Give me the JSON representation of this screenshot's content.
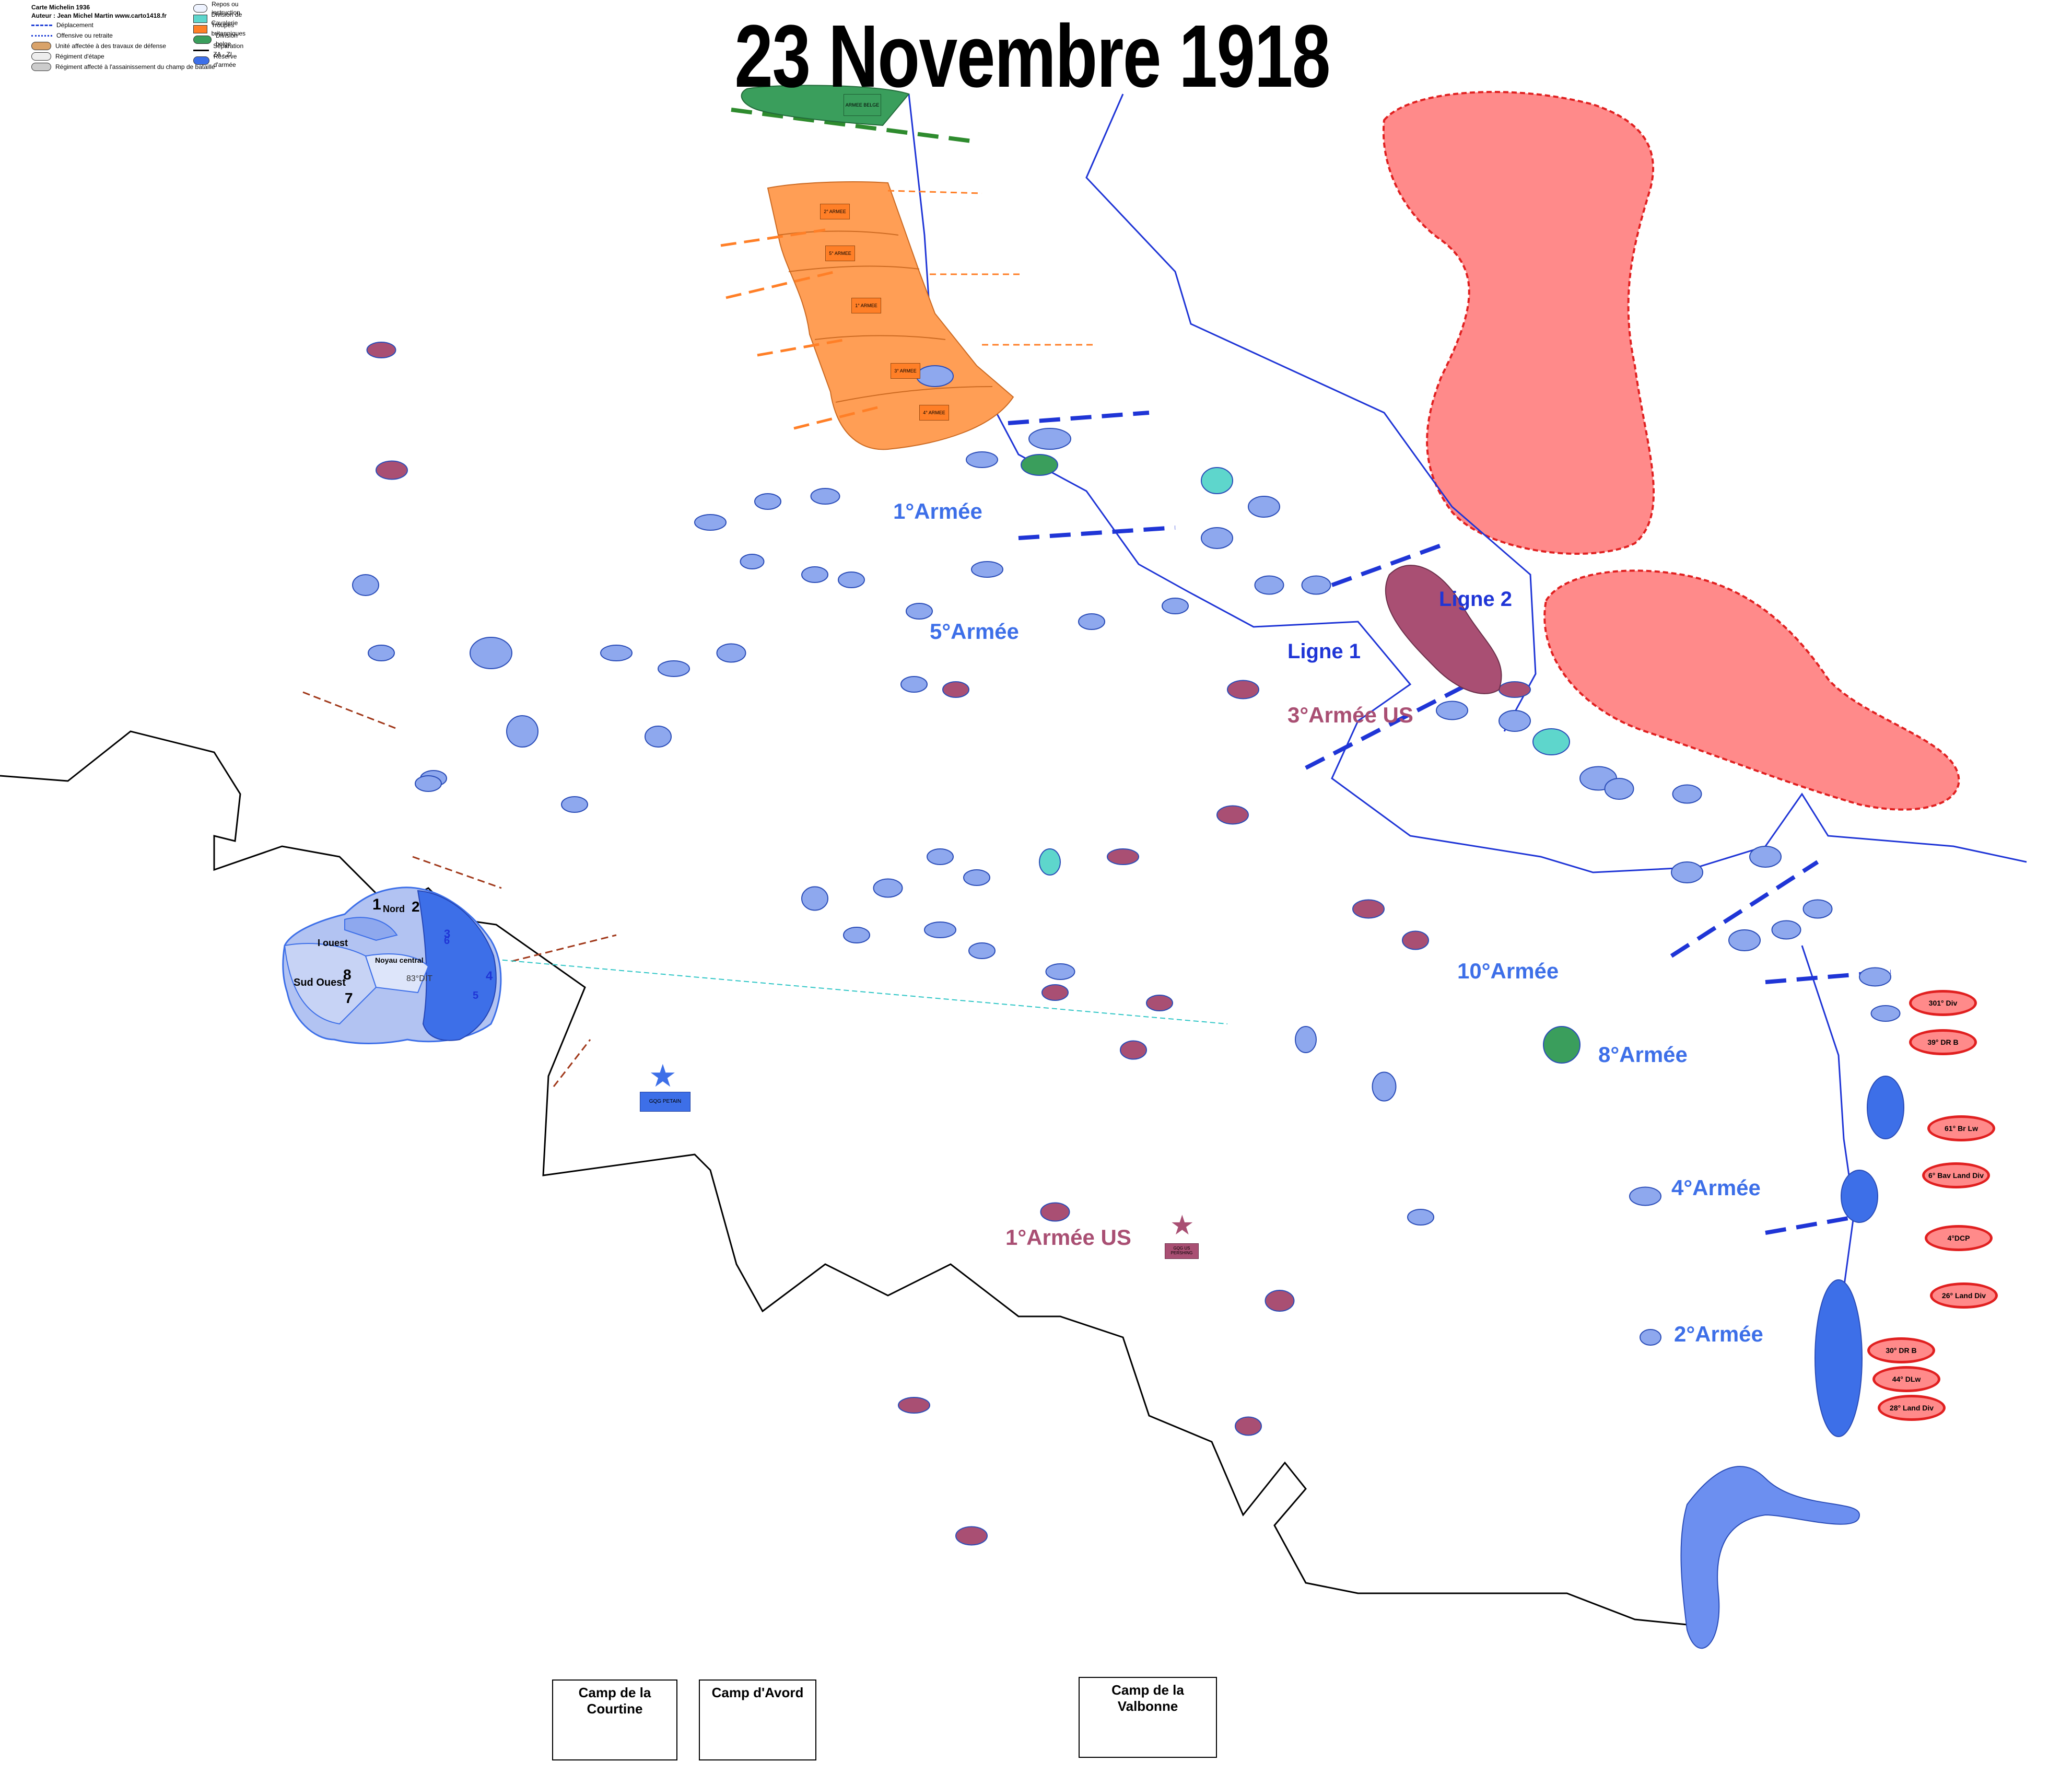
{
  "title": "23 Novembre 1918",
  "legend": {
    "credits": [
      "Carte Michelin 1936",
      "Auteur : Jean Michel Martin   www.carto1418.fr"
    ],
    "items_left": [
      {
        "label": "Déplacement",
        "icon": "dashed-arrow-icon"
      },
      {
        "label": "Offensive ou retraite",
        "icon": "dotted-arrow-icon"
      },
      {
        "label": "Unité affectée à des travaux de défense",
        "icon": "defense-work-icon"
      },
      {
        "label": "Régiment d'étape",
        "icon": "etape-regiment-icon"
      },
      {
        "label": "Régiment affecté à l'assainissement du champ de bataille",
        "icon": "battlefield-cleanup-icon"
      }
    ],
    "items_right": [
      {
        "label": "Repos ou instruction",
        "icon": "rest-icon"
      },
      {
        "label": "Division de Cavalerie",
        "icon": "cavalry-icon"
      },
      {
        "label": "Troupes britanniques",
        "icon": "british-troops-icon"
      },
      {
        "label": "Division belge",
        "icon": "belgian-division-icon"
      },
      {
        "label": "Séparation ZA - ZI",
        "icon": "za-zi-line-icon"
      },
      {
        "label": "Réserve d'armée",
        "icon": "army-reserve-icon"
      }
    ]
  },
  "colors": {
    "french": "#3d6fe8",
    "french_light": "#8ea8ee",
    "us": "#a94f73",
    "british": "#ff9e55",
    "belgian": "#3a9e5c",
    "cavalry": "#5ed6cc",
    "enemy": "#ff8a8a",
    "enemy_border": "#e02020",
    "border": "#000000",
    "lines": "#1f35d6"
  },
  "armies": [
    {
      "label": "1°Armée",
      "kind": "french"
    },
    {
      "label": "5°Armée",
      "kind": "french"
    },
    {
      "label": "10°Armée",
      "kind": "french"
    },
    {
      "label": "8°Armée",
      "kind": "french"
    },
    {
      "label": "4°Armée",
      "kind": "french"
    },
    {
      "label": "2°Armée",
      "kind": "french"
    },
    {
      "label": "3°Armée US",
      "kind": "us"
    },
    {
      "label": "1°Armée US",
      "kind": "us"
    }
  ],
  "defense_lines": [
    "Ligne 1",
    "Ligne 2"
  ],
  "german_units": [
    "301° Div",
    "39° DR B",
    "61° Br Lw",
    "6° Bav Land Div",
    "4°DCP",
    "26° Land Div",
    "30° DR B",
    "44° DLw",
    "28° Land Div"
  ],
  "paris_sectors": {
    "labels": [
      "1",
      "2",
      "Nord",
      "I ouest",
      "Sud Ouest",
      "8",
      "7",
      "Noyau central",
      "3",
      "4",
      "5",
      "6"
    ],
    "unit": "83°DIT"
  },
  "headquarters": [
    {
      "label": "GQG PETAIN",
      "kind": "french"
    },
    {
      "label": "GQG US PERSHING",
      "kind": "us"
    }
  ],
  "british_armies": [
    "2° ARMEE",
    "5° ARMEE",
    "1° ARMEE",
    "3° ARMEE",
    "4° ARMEE"
  ],
  "belgian_army": "ARMEE BELGE",
  "camps": [
    "Camp de la Courtine",
    "Camp d'Avord",
    "Camp de la Valbonne"
  ]
}
